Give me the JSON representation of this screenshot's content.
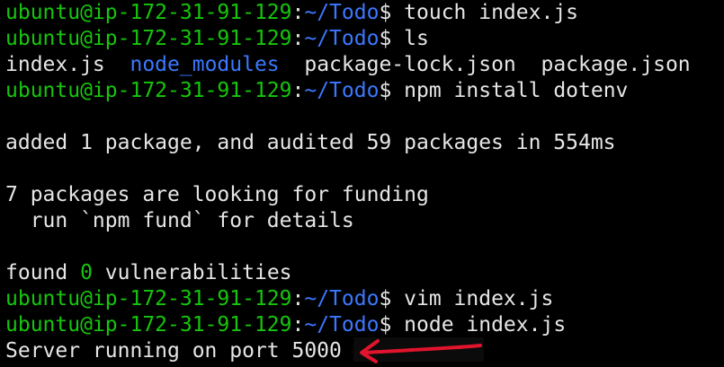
{
  "terminal": {
    "prompt": {
      "user_host": "ubuntu@ip-172-31-91-129",
      "colon": ":",
      "path": "~/Todo",
      "symbol": "$ "
    },
    "lines": [
      {
        "type": "prompt",
        "command": "touch index.js"
      },
      {
        "type": "prompt",
        "command": "ls"
      },
      {
        "type": "ls",
        "items": [
          {
            "text": "index.js",
            "kind": "file"
          },
          {
            "text": "  ",
            "kind": "sep"
          },
          {
            "text": "node_modules",
            "kind": "dir"
          },
          {
            "text": "  ",
            "kind": "sep"
          },
          {
            "text": "package-lock.json",
            "kind": "file"
          },
          {
            "text": "  ",
            "kind": "sep"
          },
          {
            "text": "package.json",
            "kind": "file"
          }
        ]
      },
      {
        "type": "prompt",
        "command": "npm install dotenv"
      },
      {
        "type": "text",
        "text": ""
      },
      {
        "type": "text",
        "text": "added 1 package, and audited 59 packages in 554ms"
      },
      {
        "type": "text",
        "text": ""
      },
      {
        "type": "text",
        "text": "7 packages are looking for funding"
      },
      {
        "type": "text",
        "text": "  run `npm fund` for details"
      },
      {
        "type": "text",
        "text": ""
      },
      {
        "type": "found",
        "pre": "found ",
        "count": "0",
        "post": " vulnerabilities"
      },
      {
        "type": "prompt",
        "command": "vim index.js"
      },
      {
        "type": "prompt",
        "command": "node index.js"
      },
      {
        "type": "text",
        "text": "Server running on port 5000"
      }
    ]
  },
  "colors": {
    "background": "#000000",
    "prompt_user_host": "#16c60c",
    "prompt_path": "#3b78ff",
    "text": "#e6e6e6",
    "directory": "#3b78ff",
    "zero_count": "#16c60c",
    "annotation_arrow": "#e0142c"
  },
  "annotation": {
    "icon": "arrow-annotation-icon"
  }
}
